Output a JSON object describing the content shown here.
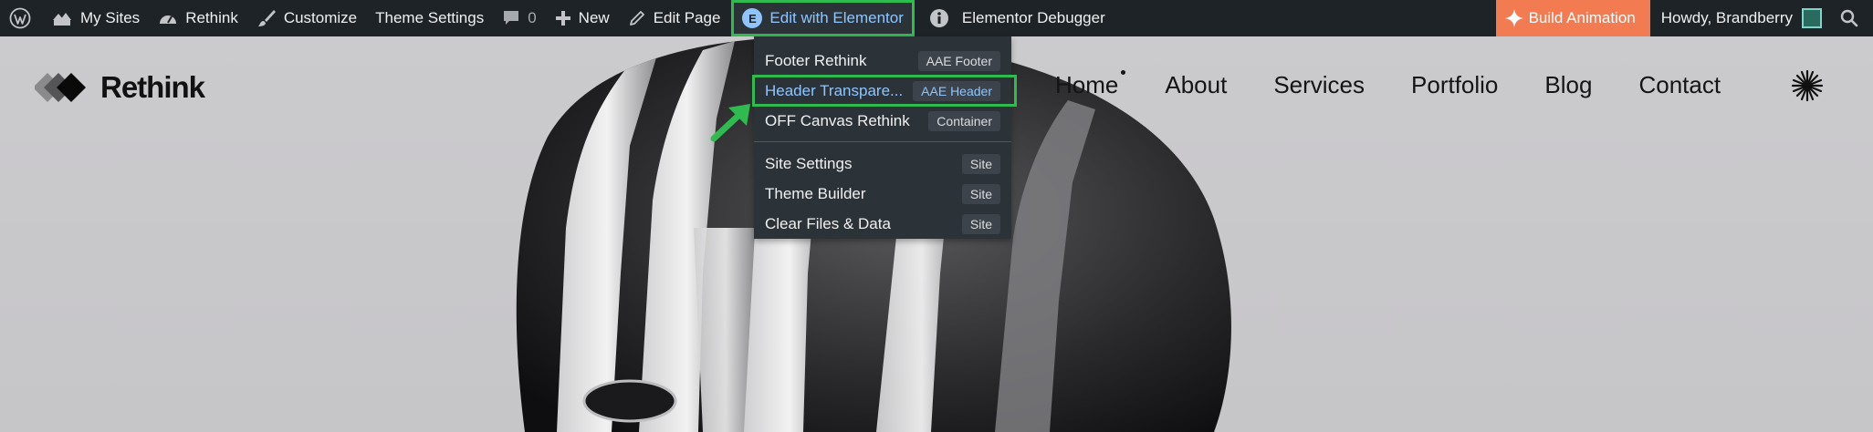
{
  "adminbar": {
    "my_sites": "My Sites",
    "site_name": "Rethink",
    "customize": "Customize",
    "theme_settings": "Theme Settings",
    "comments_count": "0",
    "new": "New",
    "edit_page": "Edit Page",
    "edit_with_elementor": "Edit with Elementor",
    "elementor_icon_letter": "E",
    "debugger": "Elementor Debugger",
    "build_animation": "Build Animation",
    "howdy": "Howdy, Brandberry"
  },
  "elementor_menu": {
    "items": [
      {
        "label": "Footer Rethink",
        "badge": "AAE Footer"
      },
      {
        "label": "Header Transpare...",
        "badge": "AAE Header"
      },
      {
        "label": "OFF Canvas Rethink",
        "badge": "Container"
      }
    ],
    "site_items": [
      {
        "label": "Site Settings",
        "badge": "Site"
      },
      {
        "label": "Theme Builder",
        "badge": "Site"
      },
      {
        "label": "Clear Files & Data",
        "badge": "Site"
      }
    ]
  },
  "site": {
    "logo_text": "Rethink",
    "nav": [
      "Home",
      "About",
      "Services",
      "Portfolio",
      "Blog",
      "Contact"
    ]
  },
  "colors": {
    "adminbar_bg": "#1d2327",
    "highlight_green": "#2fbb4f",
    "build_animation_bg": "#f27b52",
    "elementor_blue": "#8ec5ff"
  }
}
